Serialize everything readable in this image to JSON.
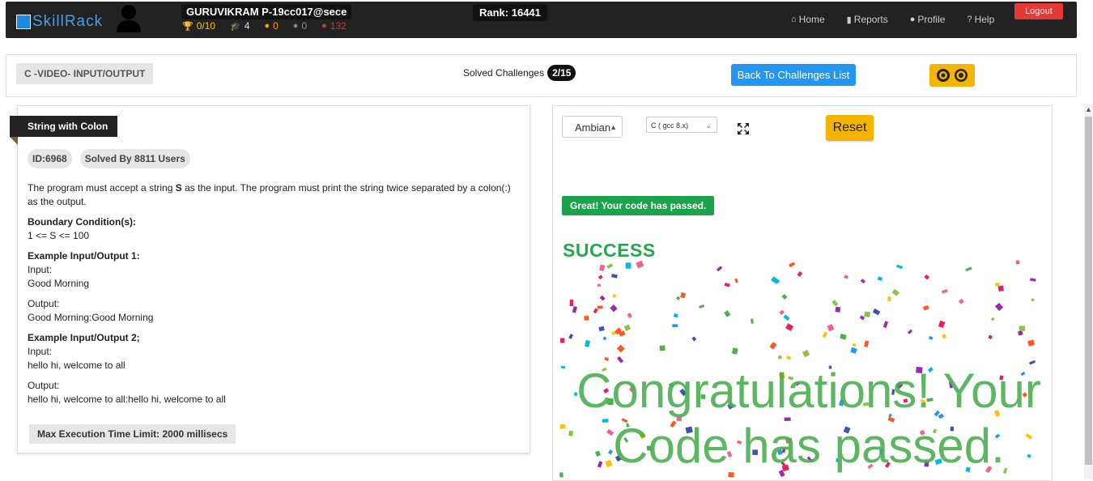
{
  "navbar": {
    "brand": "SkillRack",
    "username": "GURUVIKRAM P-19cc017@sece",
    "stats": [
      {
        "icon": "trophy-icon",
        "value": "0/10",
        "color": "#f5c518"
      },
      {
        "icon": "graduation-cap-icon",
        "value": "4",
        "color": "#dddddd"
      },
      {
        "icon": "gold-medal-icon",
        "value": "0",
        "color": "#f39c12"
      },
      {
        "icon": "silver-medal-icon",
        "value": "0",
        "color": "#888888"
      },
      {
        "icon": "bronze-medal-icon",
        "value": "132",
        "color": "#c0392b"
      }
    ],
    "rank": "Rank: 16441",
    "links": [
      {
        "icon": "home-icon",
        "label": "Home"
      },
      {
        "icon": "bar-chart-icon",
        "label": "Reports"
      },
      {
        "icon": "user-icon",
        "label": "Profile"
      },
      {
        "icon": "question-icon",
        "label": "Help"
      }
    ],
    "logout": "Logout"
  },
  "challenge_bar": {
    "category": "C -VIDEO- INPUT/OUTPUT",
    "solved_label": "Solved Challenges",
    "solved_count": "2/15",
    "back_button": "Back To Challenges List"
  },
  "problem": {
    "title": "String with Colon",
    "id": "ID:6968",
    "solved_by": "Solved By 8811 Users",
    "desc_pre": "The program must accept a string ",
    "desc_var": "S",
    "desc_post": " as the input. The program must print the string twice separated by a colon(:) as the output.",
    "boundary_heading": "Boundary Condition(s):",
    "boundary": "1 <= S <= 100",
    "ex1_heading": "Example Input/Output 1:",
    "ex1_input_label": "Input:",
    "ex1_input": "Good Morning",
    "ex1_output_label": "Output:",
    "ex1_output": "Good Morning:Good Morning",
    "ex2_heading": "Example Input/Output 2;",
    "ex2_input_label": "Input:",
    "ex2_input": "hello hi, welcome to all",
    "ex2_output_label": "Output:",
    "ex2_output": "hello hi, welcome to all:hello hi, welcome to all",
    "max_time": "Max Execution Time Limit: 2000 millisecs"
  },
  "editor": {
    "theme": "Ambian",
    "language": "C ( gcc 8.x)",
    "reset": "Reset",
    "passed_message": "Great! Your code has passed.",
    "success": "SUCCESS",
    "congrats": "Congratulations! Your Code has passed."
  }
}
